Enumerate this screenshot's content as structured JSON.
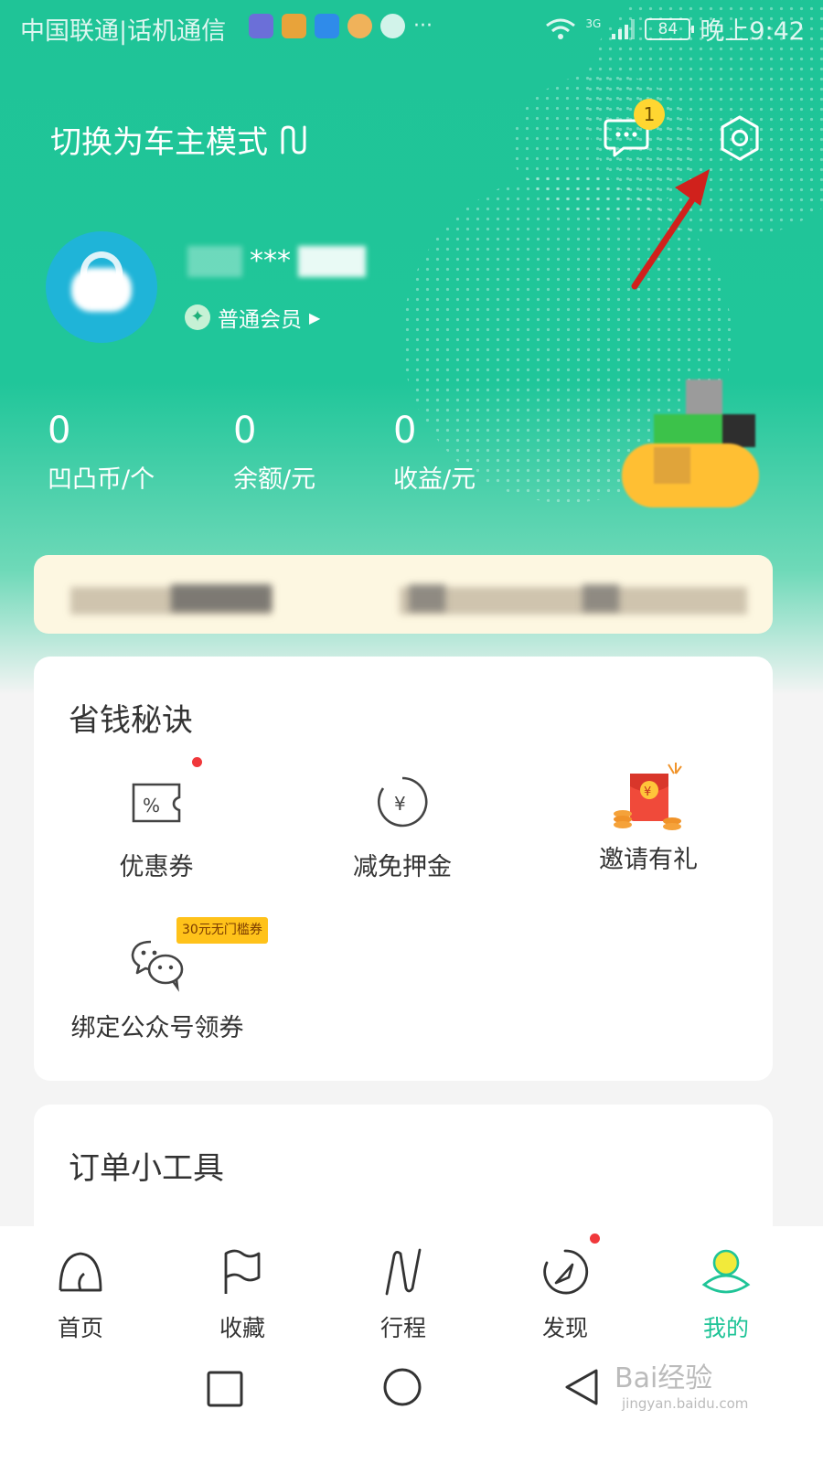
{
  "status_bar": {
    "carrier": "中国联通|话机通信",
    "more": "···",
    "network": "3G",
    "battery": "84",
    "time": "晚上9:42"
  },
  "header": {
    "mode_switch_label": "切换为车主模式",
    "message_badge": "1"
  },
  "profile": {
    "username_masked": "***",
    "member_level": "普通会员"
  },
  "stats": [
    {
      "value": "0",
      "label": "凹凸币/个"
    },
    {
      "value": "0",
      "label": "余额/元"
    },
    {
      "value": "0",
      "label": "收益/元"
    }
  ],
  "savings_card": {
    "title": "省钱秘诀",
    "items": [
      {
        "label": "优惠券",
        "icon": "coupon-icon"
      },
      {
        "label": "减免押金",
        "icon": "yuan-circle-icon"
      },
      {
        "label": "邀请有礼",
        "icon": "red-envelope-icon"
      },
      {
        "label": "绑定公众号领券",
        "icon": "wechat-icon"
      }
    ],
    "coupon_tag": "30元无门槛券"
  },
  "tools_card": {
    "title": "订单小工具"
  },
  "bottom_nav": [
    {
      "label": "首页",
      "icon": "home-icon"
    },
    {
      "label": "收藏",
      "icon": "flag-icon"
    },
    {
      "label": "行程",
      "icon": "route-icon"
    },
    {
      "label": "发现",
      "icon": "compass-icon"
    },
    {
      "label": "我的",
      "icon": "profile-icon"
    }
  ],
  "watermark": {
    "brand": "Bai经验",
    "url": "jingyan.baidu.com"
  },
  "colors": {
    "brand_green": "#1fc497",
    "badge_yellow": "#ffd631",
    "red_dot": "#f0383b",
    "notice_bg": "#fdf7e1"
  }
}
